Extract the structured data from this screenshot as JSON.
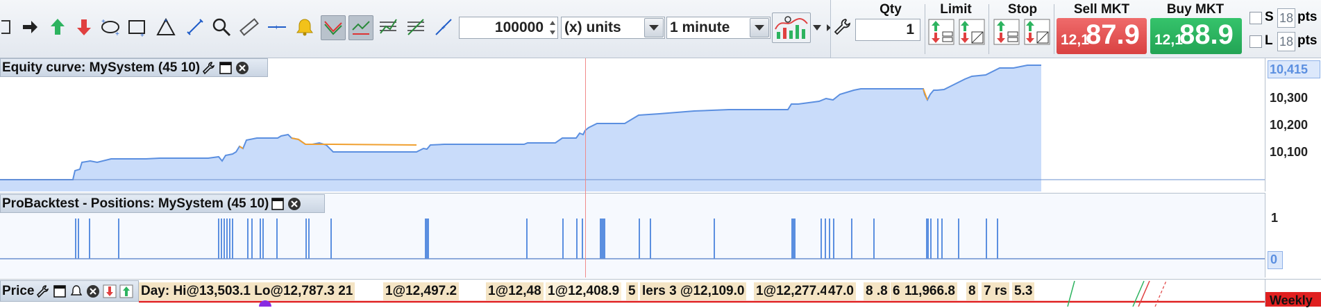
{
  "toolbar": {
    "tools": [
      "partial-left-icon",
      "arrow-right-icon",
      "buy-arrow-icon",
      "sell-arrow-icon",
      "ellipse-tool-icon",
      "rectangle-tool-icon",
      "triangle-tool-icon",
      "fibonacci-icon",
      "zoom-icon",
      "ruler-icon",
      "horizontal-line-icon",
      "alert-bell-icon",
      "trend-down-icon",
      "trend-up-icon",
      "indicator-icon",
      "channel-icon",
      "line-tool-icon"
    ],
    "quantity_value": "100000",
    "units_label": "(x) units",
    "timeframe_label": "1 minute",
    "chart_type_icon": "chart-type-icon"
  },
  "order_panel": {
    "qty_label": "Qty",
    "qty_value": "1",
    "limit_label": "Limit",
    "stop_label": "Stop",
    "sell_label": "Sell MKT",
    "buy_label": "Buy MKT",
    "sell_price_prefix": "12,1",
    "sell_price_main": "87.9",
    "buy_price_prefix": "12,1",
    "buy_price_main": "88.9",
    "s_label": "S",
    "l_label": "L",
    "s_pts": "18",
    "l_pts": "18",
    "pts_label": "pts"
  },
  "colors": {
    "equity_line": "#5b8fe0",
    "equity_fill": "#c9dcfa",
    "equity_orange": "#f0a030",
    "position_bar": "#5b8fe0",
    "sell": "#e04f4f",
    "buy": "#2db35f",
    "cursor_line": "#f08a8a"
  },
  "equity_panel": {
    "title": "Equity curve: MySystem (45 10)",
    "y_ticks": [
      "10,415",
      "10,300",
      "10,200",
      "10,100"
    ]
  },
  "positions_panel": {
    "title": "ProBacktest - Positions: MySystem (45 10)",
    "y_ticks": [
      "1",
      "0"
    ]
  },
  "price_panel": {
    "title": "Price",
    "tags": [
      "Day: Hi@13,503.1 Lo@12,787.3 21",
      "1@12,497.2",
      "1@12,48",
      "1@12,408.9",
      "5",
      "lers 3 @12,109.0",
      "1@12,277.4",
      "47.0",
      "8 .8",
      "6",
      "11,966.8",
      "8",
      "7 rs",
      "5.3"
    ],
    "weekly_label": "Weekly"
  }
}
